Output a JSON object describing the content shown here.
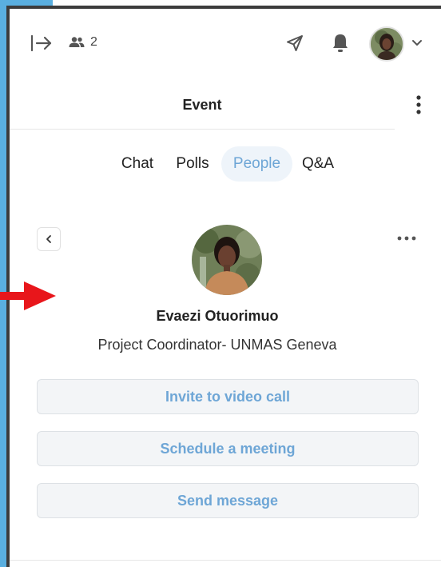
{
  "header": {
    "participant_count": "2"
  },
  "event": {
    "title": "Event"
  },
  "tabs": [
    {
      "label": "Chat",
      "active": false
    },
    {
      "label": "Polls",
      "active": false
    },
    {
      "label": "People",
      "active": true
    },
    {
      "label": "Q&A",
      "active": false
    }
  ],
  "profile": {
    "name": "Evaezi Otuorimuo",
    "role": "Project Coordinator- UNMAS Geneva"
  },
  "actions": {
    "invite_label": "Invite to video call",
    "schedule_label": "Schedule a meeting",
    "message_label": "Send message"
  },
  "icons": [
    "exit-icon",
    "people-icon",
    "send-icon",
    "bell-icon",
    "avatar",
    "chevron-down-icon",
    "kebab-menu-icon",
    "chevron-left-icon",
    "more-horizontal-icon",
    "red-arrow-icon"
  ],
  "colors": {
    "accent": "#6ea6d6",
    "active_tab_bg": "#eef4fa",
    "left_strip": "#5aafe0",
    "annotation_arrow": "#e8161b"
  }
}
